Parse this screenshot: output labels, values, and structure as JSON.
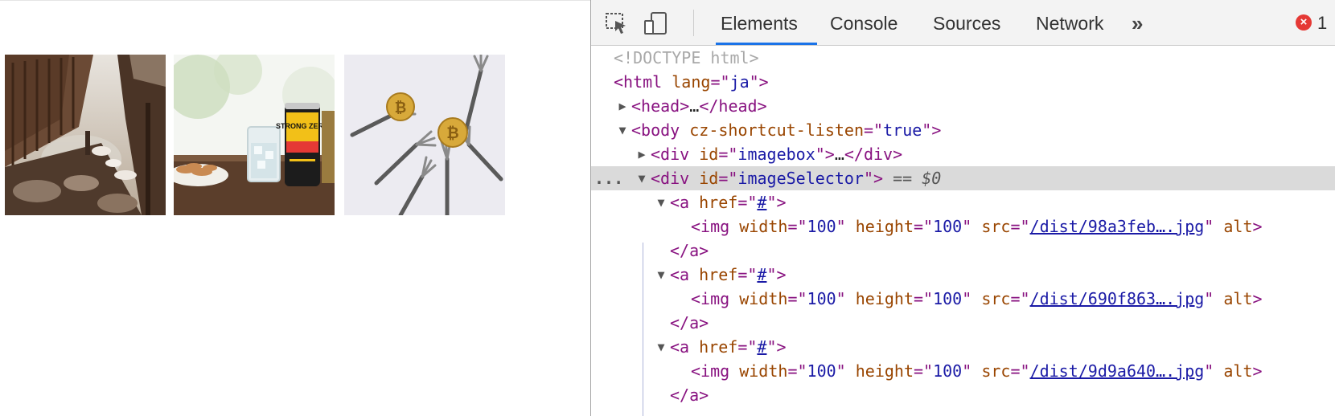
{
  "images": [
    {
      "name": "hot-spring-onsen-image"
    },
    {
      "name": "strong-zero-drink-image",
      "can_text": "STRONG ZERO"
    },
    {
      "name": "bitcoin-forks-image"
    }
  ],
  "devtools": {
    "tabs": [
      {
        "label": "Elements",
        "active": true
      },
      {
        "label": "Console"
      },
      {
        "label": "Sources"
      },
      {
        "label": "Network"
      }
    ],
    "overflow_label": "»",
    "error_count": "1",
    "error_icon": "×",
    "tree": {
      "doctype": "<!DOCTYPE html>",
      "html_tag": "html",
      "lang_attr": "lang",
      "lang_val": "ja",
      "head_tag": "head",
      "ellipsis": "…",
      "body_tag": "body",
      "body_attr": "cz-shortcut-listen",
      "body_val": "true",
      "div_tag": "div",
      "id_attr": "id",
      "imagebox_id": "imagebox",
      "imageselector_id": "imageSelector",
      "selected_marker": "== $0",
      "row_dots": "...",
      "a_tag": "a",
      "href_attr": "href",
      "href_val": "#",
      "img_tag": "img",
      "width_attr": "width",
      "width_val": "100",
      "height_attr": "height",
      "height_val": "100",
      "src_attr": "src",
      "alt_attr": "alt",
      "srcs": [
        "/dist/98a3feb….jpg",
        "/dist/690f863….jpg",
        "/dist/9d9a640….jpg"
      ]
    }
  },
  "colors": {
    "tag": "#881280",
    "attribute": "#994500",
    "value": "#1a1aa6",
    "accent": "#1a73e8",
    "error": "#e53935"
  }
}
